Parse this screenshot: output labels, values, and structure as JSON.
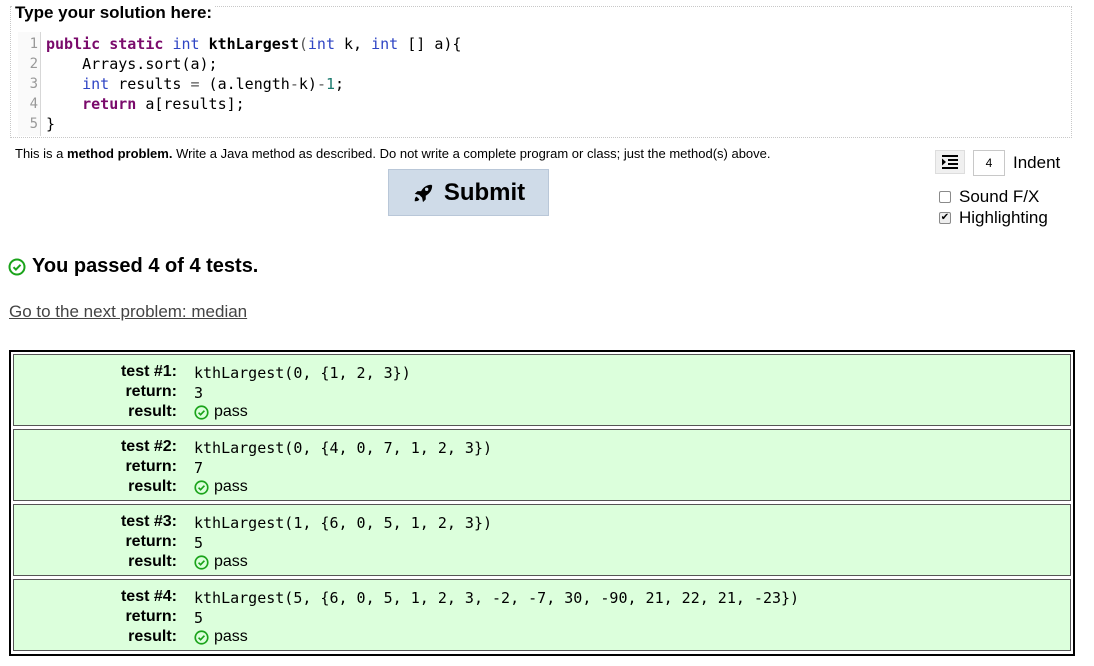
{
  "editor": {
    "legend": "Type your solution here:",
    "lines": [
      {
        "n": "1",
        "tokens": [
          [
            "kw",
            "public"
          ],
          [
            "sp",
            " "
          ],
          [
            "kw",
            "static"
          ],
          [
            "sp",
            " "
          ],
          [
            "ty",
            "int"
          ],
          [
            "sp",
            " "
          ],
          [
            "fn",
            "kthLargest"
          ],
          [
            "op",
            "("
          ],
          [
            "ty",
            "int"
          ],
          [
            "sp",
            " k, "
          ],
          [
            "ty",
            "int"
          ],
          [
            "sp",
            " [] a){"
          ]
        ]
      },
      {
        "n": "2",
        "tokens": [
          [
            "sp",
            "    Arrays.sort(a);"
          ]
        ]
      },
      {
        "n": "3",
        "tokens": [
          [
            "sp",
            "    "
          ],
          [
            "ty",
            "int"
          ],
          [
            "sp",
            " results "
          ],
          [
            "op",
            "="
          ],
          [
            "sp",
            " (a.length"
          ],
          [
            "op",
            "-"
          ],
          [
            "sp",
            "k)"
          ],
          [
            "op",
            "-"
          ],
          [
            "num",
            "1"
          ],
          [
            "sp",
            ";"
          ]
        ]
      },
      {
        "n": "4",
        "tokens": [
          [
            "sp",
            "    "
          ],
          [
            "kw",
            "return"
          ],
          [
            "sp",
            " a[results];"
          ]
        ]
      },
      {
        "n": "5",
        "tokens": [
          [
            "sp",
            "}"
          ]
        ]
      }
    ]
  },
  "help": {
    "prefix": "This is a ",
    "bold": "method problem.",
    "suffix": " Write a Java method as described. Do not write a complete program or class; just the method(s) above."
  },
  "submit": {
    "label": "Submit"
  },
  "options": {
    "indent_value": "4",
    "indent_label": "Indent",
    "sound_label": "Sound F/X",
    "sound_checked": false,
    "highlight_label": "Highlighting",
    "highlight_checked": true
  },
  "results": {
    "summary": "You passed 4 of 4 tests.",
    "next_link": "Go to the next problem: median",
    "labels": {
      "test_prefix": "test #",
      "return": "return:",
      "result": "result:"
    },
    "tests": [
      {
        "label": "test #1:",
        "call": "kthLargest(0, {1, 2, 3})",
        "ret": "3",
        "result": "pass"
      },
      {
        "label": "test #2:",
        "call": "kthLargest(0, {4, 0, 7, 1, 2, 3})",
        "ret": "7",
        "result": "pass"
      },
      {
        "label": "test #3:",
        "call": "kthLargest(1, {6, 0, 5, 1, 2, 3})",
        "ret": "5",
        "result": "pass"
      },
      {
        "label": "test #4:",
        "call": "kthLargest(5, {6, 0, 5, 1, 2, 3, -2, -7, 30, -90, 21, 22, 21, -23})",
        "ret": "5",
        "result": "pass"
      }
    ]
  },
  "colors": {
    "pass_green": "#1aa31a",
    "row_bg": "#dcffdc",
    "submit_bg": "#cfdbe8"
  }
}
